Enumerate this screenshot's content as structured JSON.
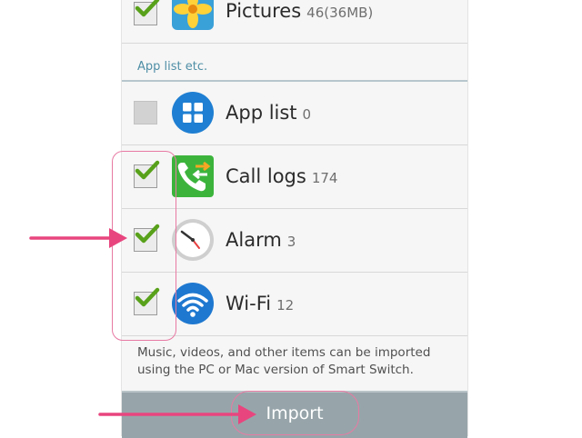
{
  "data_categories": [
    {
      "label": "Pictures",
      "count": "46(36MB)",
      "checked": true
    },
    {
      "label": "App list",
      "count": "0",
      "checked": false
    },
    {
      "label": "Call logs",
      "count": "174",
      "checked": true
    },
    {
      "label": "Alarm",
      "count": "3",
      "checked": true
    },
    {
      "label": "Wi-Fi",
      "count": "12",
      "checked": true
    }
  ],
  "section_header": "App list etc.",
  "footer_note": "Music, videos, and other items can be imported using the PC or Mac version of Smart Switch.",
  "import_button_label": "Import",
  "icons": {
    "pictures": "pictures-app-icon",
    "app_list": "app-grid-icon",
    "call_logs": "call-log-icon",
    "alarm": "alarm-clock-icon",
    "wifi": "wifi-icon"
  },
  "colors": {
    "checkmark": "#58a11a",
    "annotation": "#e8457e",
    "import_bar": "#97a5aa",
    "section_header": "#4f8fa6"
  }
}
